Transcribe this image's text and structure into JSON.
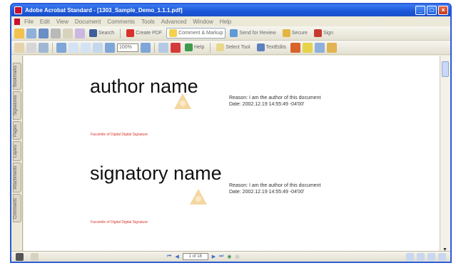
{
  "window": {
    "title": "Adobe Acrobat Standard - [1303_Sample_Demo_1.1.1.pdf]"
  },
  "menu": [
    "File",
    "Edit",
    "View",
    "Document",
    "Comments",
    "Tools",
    "Advanced",
    "Window",
    "Help"
  ],
  "toolbar1": {
    "search_label": "Search",
    "create_pdf_label": "Create PDF",
    "comment_label": "Comment & Markup",
    "send_label": "Send for Review",
    "secure_label": "Secure",
    "sign_label": "Sign"
  },
  "toolbar2": {
    "zoom": "100%",
    "help_label": "Help",
    "select_tool_label": "Select Tool",
    "text_edits_label": "TextEdits"
  },
  "navpane": {
    "tabs": [
      "Bookmarks",
      "Signatures",
      "Pages",
      "Layers",
      "Attachments",
      "Comments"
    ]
  },
  "signatures": [
    {
      "name": "author name",
      "reason": "Reason: I am the author of this document",
      "date": "Date: 2002.12.19 14:55:49 -04'00'",
      "caption": "Facsimile of Digital Digital Signature"
    },
    {
      "name": "signatory name",
      "reason": "Reason: I am the author of this document",
      "date": "Date: 2002.12.19 14:55:49 -04'00'",
      "caption": "Facsimile of Digital Digital Signature"
    }
  ],
  "statusbar": {
    "page_indicator": "1 of 18"
  },
  "colors": {
    "titlebar": "#1c56d8",
    "caption_red": "#d9342b",
    "watermark": "#f0c98a"
  }
}
